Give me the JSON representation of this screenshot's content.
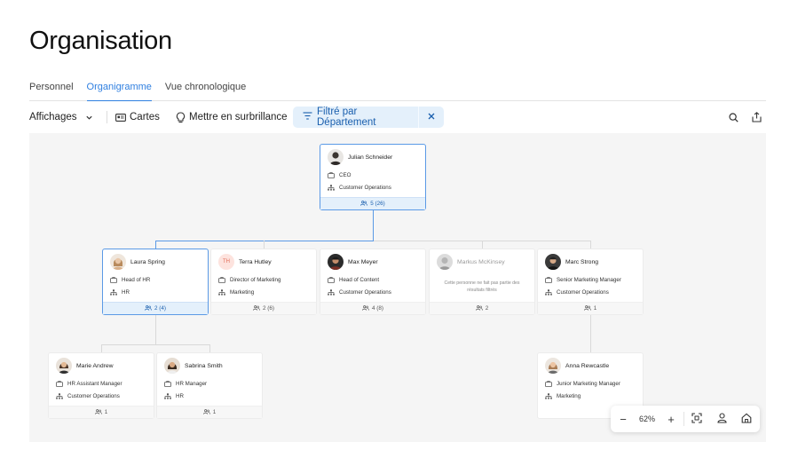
{
  "page": {
    "title": "Organisation"
  },
  "tabs": [
    {
      "label": "Personnel",
      "active": false
    },
    {
      "label": "Organigramme",
      "active": true
    },
    {
      "label": "Vue chronologique",
      "active": false
    }
  ],
  "toolbar": {
    "views_label": "Affichages",
    "cards_label": "Cartes",
    "highlight_label": "Mettre en surbrillance",
    "filter_label": "Filtré par Département",
    "accent_color": "#2f7fe0",
    "filter_bg": "#e4f0fb"
  },
  "org": {
    "root": {
      "name": "Julian Schneider",
      "title": "CEO",
      "department": "Customer Operations",
      "count": "5 (26)",
      "avatar": "person-photo"
    },
    "level1": [
      {
        "name": "Laura Spring",
        "title": "Head of HR",
        "department": "HR",
        "count": "2 (4)",
        "avatar": "person-photo"
      },
      {
        "name": "Terra Hutley",
        "initials": "TH",
        "title": "Director of Marketing",
        "department": "Marketing",
        "count": "2 (6)"
      },
      {
        "name": "Max Meyer",
        "title": "Head of Content",
        "department": "Customer Operations",
        "count": "4 (8)",
        "avatar": "person-photo"
      },
      {
        "name": "Markus McKinsey",
        "note": "Cette personne ne fait pas partie des résultats filtrés",
        "count": "2",
        "avatar": "person-photo"
      },
      {
        "name": "Marc Strong",
        "title": "Senior Marketing Manager",
        "department": "Customer Operations",
        "count": "1",
        "avatar": "person-photo"
      }
    ],
    "level2": [
      {
        "name": "Marie Andrew",
        "title": "HR Assistant Manager",
        "department": "Customer Operations",
        "count": "1",
        "avatar": "person-photo"
      },
      {
        "name": "Sabrina Smith",
        "title": "HR Manager",
        "department": "HR",
        "count": "1",
        "avatar": "person-photo"
      },
      {
        "name": "Anna Rewcastle",
        "title": "Junior Marketing Manager",
        "department": "Marketing",
        "avatar": "person-photo"
      }
    ]
  },
  "zoom": {
    "level": "62%",
    "minus_label": "−",
    "plus_label": "+"
  },
  "icons": [
    "chevron-down-icon",
    "cards-icon",
    "lightbulb-icon",
    "filter-icon",
    "close-icon",
    "search-icon",
    "share-icon",
    "briefcase-icon",
    "org-tree-icon",
    "people-icon",
    "fit-screen-icon",
    "person-icon",
    "home-icon"
  ]
}
